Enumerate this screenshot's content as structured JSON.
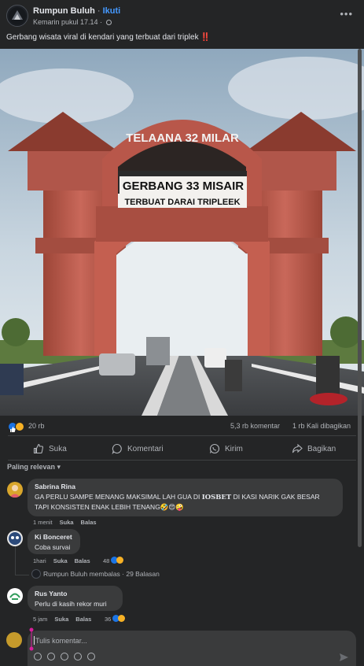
{
  "header": {
    "page_name": "Rumpun Buluh",
    "separator": " · ",
    "follow_label": "Ikuti",
    "timestamp": "Kemarin pukul 17.14 ·",
    "more_label": "•••",
    "caption": "Gerbang wisata viral di kendari yang terbuat dari triplek",
    "caption_emoji": "‼️"
  },
  "image": {
    "line1": "TELAANA 32 MILAR",
    "line2": "GERBANG 33 MISAIR",
    "line3": "TERBUAT DARAI TRIPLEEK"
  },
  "stats": {
    "reaction_count": "20 rb",
    "comments": "5,3 rb komentar",
    "shares": "1 rb Kali dibagikan"
  },
  "actions": {
    "like": "Suka",
    "comment": "Komentari",
    "send": "Kirim",
    "share": "Bagikan"
  },
  "sort_label": "Paling relevan",
  "comments": [
    {
      "name": "Sabrina Rina",
      "text_before": "GA PERLU SAMPE MENANG MAKSIMAL LAH GUA DI ",
      "brand": "IOSBET",
      "text_after": " DI KASI NARIK GAK BESAR TAPI KONSISTEN ENAK LEBIH TENANG🤣😍🤪",
      "time": "1 menit",
      "like": "Suka",
      "reply": "Balas"
    },
    {
      "name": "Ki Bonceret",
      "text": "Coba survai",
      "time": "1hari",
      "like": "Suka",
      "reply": "Balas",
      "reactions": "48"
    },
    {
      "name": "Rus Yanto",
      "text": "Perlu di kasih rekor muri",
      "time": "5 jam",
      "like": "Suka",
      "reply": "Balas",
      "reactions": "36"
    }
  ],
  "reply_summary": "Rumpun Buluh membalas · 29 Balasan",
  "composer": {
    "placeholder": "Tulis komentar..."
  },
  "colors": {
    "background": "#242526",
    "bubble": "#3a3b3c",
    "accent": "#4599ff",
    "like_blue": "#1b74e4",
    "haha_yellow": "#f7b125",
    "gate_terracotta": "#b8574a"
  }
}
